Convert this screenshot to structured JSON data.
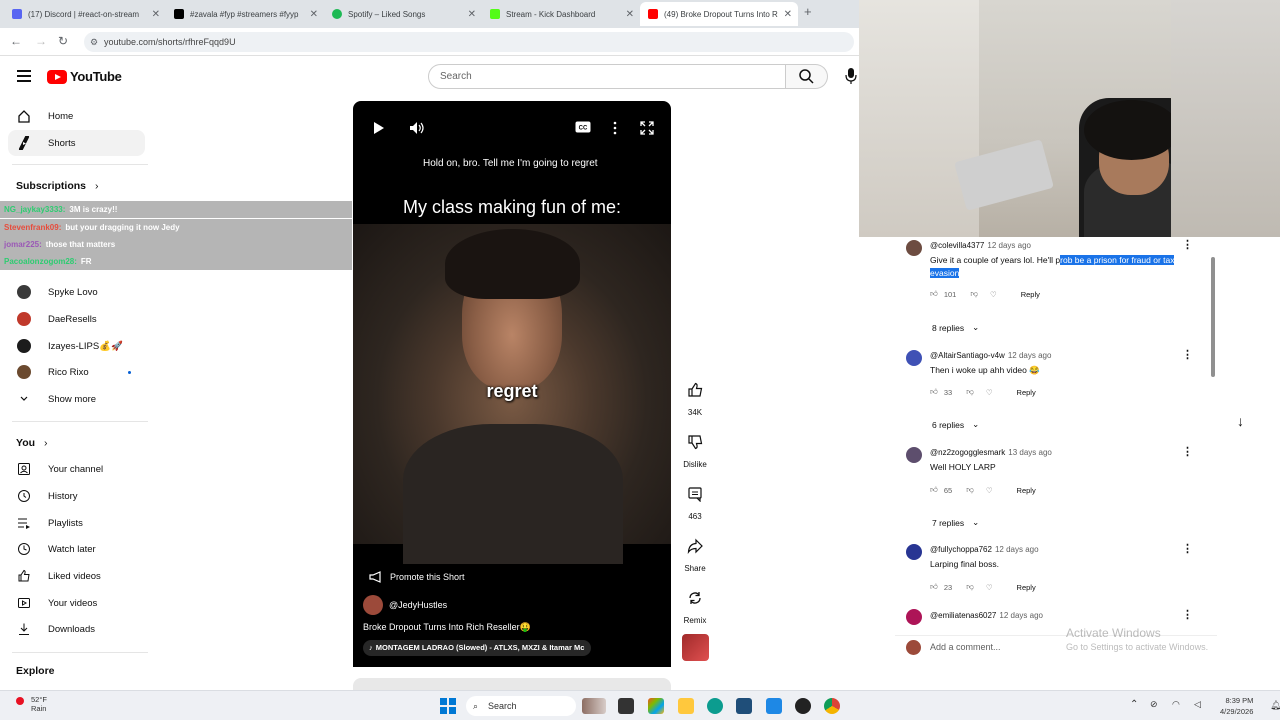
{
  "browser": {
    "tabs": [
      {
        "title": "(17) Discord | #react-on-stream",
        "color": "#5865f2"
      },
      {
        "title": "#zavala #fyp #streamers #fyyp",
        "color": "#000000"
      },
      {
        "title": "Spotify – Liked Songs",
        "color": "#1db954"
      },
      {
        "title": "Stream - Kick Dashboard",
        "color": "#53fc18"
      },
      {
        "title": "(49) Broke Dropout Turns Into R",
        "color": "#ff0000"
      }
    ],
    "url": "youtube.com/shorts/rfhreFqqd9U"
  },
  "youtube": {
    "logo_text": "YouTube",
    "search_placeholder": "Search"
  },
  "sidebar": {
    "top_items": [
      {
        "label": "Home",
        "icon": "home-icon"
      },
      {
        "label": "Shorts",
        "icon": "shorts-icon"
      }
    ],
    "subscriptions_heading": "Subscriptions",
    "subscriptions": [
      {
        "label": "Spyke Lovo",
        "color": "#3a3a3a"
      },
      {
        "label": "DaeResells",
        "color": "#c0392b"
      },
      {
        "label": "Izayes-LIPS💰🚀",
        "color": "#1c1c1c"
      },
      {
        "label": "Rico Rixo",
        "color": "#6b4a2f"
      }
    ],
    "show_more": "Show more",
    "you_heading": "You",
    "you_items": [
      {
        "label": "Your channel",
        "icon": "channel-icon"
      },
      {
        "label": "History",
        "icon": "history-icon"
      },
      {
        "label": "Playlists",
        "icon": "playlists-icon"
      },
      {
        "label": "Watch later",
        "icon": "watch-later-icon"
      },
      {
        "label": "Liked videos",
        "icon": "like-icon"
      },
      {
        "label": "Your videos",
        "icon": "your-videos-icon"
      },
      {
        "label": "Downloads",
        "icon": "download-icon"
      }
    ],
    "explore_heading": "Explore"
  },
  "chat": [
    {
      "user": "NG_jaykay3333:",
      "text": "3M is crazy!!",
      "color": "#2ecc71"
    },
    {
      "user": "Stevenfrank09:",
      "text": "but your dragging it now Jedy",
      "color": "#e74c3c"
    },
    {
      "user": "jomar225:",
      "text": "those that matters",
      "color": "#9b59b6"
    },
    {
      "user": "Pacoalonzogom28:",
      "text": "FR",
      "color": "#2ecc71"
    }
  ],
  "video": {
    "caption_top": "Hold on, bro. Tell me I'm going to regret",
    "title_overlay": "My class making fun of me:",
    "subtitle": "regret",
    "promote": "Promote this Short",
    "channel": "@JedyHustles",
    "title": "Broke Dropout Turns Into Rich Reseller🤑",
    "music": "MONTAGEM LADRAO (Slowed) - ATLXS, MXZI & Itamar Mc"
  },
  "actions": {
    "likes": "34K",
    "dislike": "Dislike",
    "comments": "463",
    "share": "Share",
    "remix": "Remix"
  },
  "comments": [
    {
      "author": "@colevilla4377",
      "time": "12 days ago",
      "text_plain": "Give it a couple of years lol. He'll p",
      "text_highlight": "rob be a prison for fraud or tax evasion",
      "likes": "101",
      "reply": "Reply",
      "replies": "8 replies",
      "color": "#6d4c41"
    },
    {
      "author": "@AltairSantiago-v4w",
      "time": "12 days ago",
      "text_plain": "Then i woke up ahh video 😂",
      "text_highlight": "",
      "likes": "33",
      "reply": "Reply",
      "replies": "6 replies",
      "color": "#3f51b5"
    },
    {
      "author": "@nz2zogogglesmark",
      "time": "13 days ago",
      "text_plain": "Well HOLY LARP",
      "text_highlight": "",
      "likes": "65",
      "reply": "Reply",
      "replies": "7 replies",
      "color": "#5d4e6d"
    },
    {
      "author": "@fullychoppa762",
      "time": "12 days ago",
      "text_plain": "Larping final boss.",
      "text_highlight": "",
      "likes": "23",
      "reply": "Reply",
      "replies": "",
      "color": "#283593"
    },
    {
      "author": "@emiliatenas6027",
      "time": "12 days ago",
      "text_plain": "",
      "text_highlight": "",
      "likes": "",
      "reply": "",
      "replies": "",
      "color": "#ad1457"
    }
  ],
  "add_comment": "Add a comment...",
  "windows_watermark": {
    "title": "Activate Windows",
    "subtitle": "Go to Settings to activate Windows."
  },
  "taskbar": {
    "weather_temp": "52°F",
    "weather_cond": "Rain",
    "search": "Search",
    "time": "8:39 PM",
    "date": "4/29/2026"
  }
}
